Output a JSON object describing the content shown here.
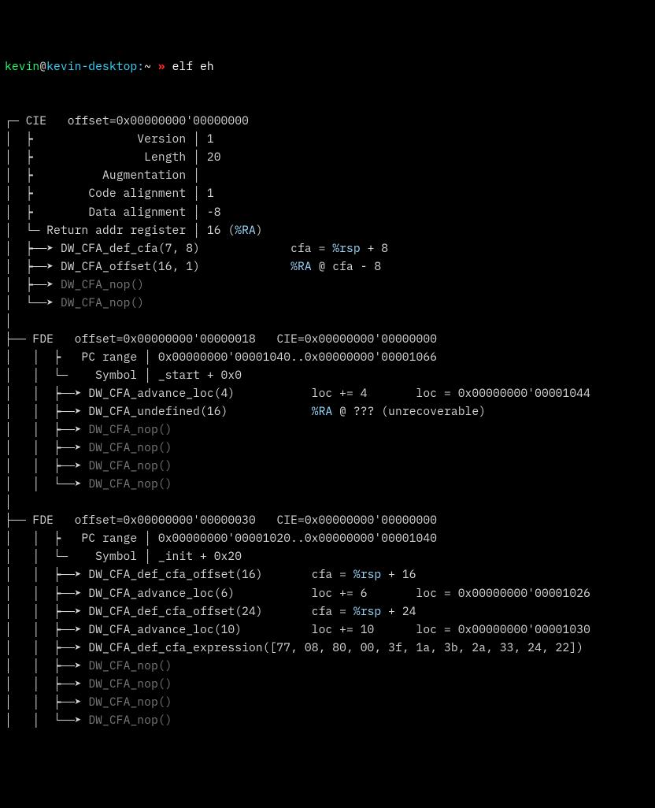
{
  "prompt": {
    "user": "kevin",
    "host": "kevin-desktop",
    "colon": ":",
    "path": "~",
    "arrows": "»",
    "cmd": "elf eh"
  },
  "t": {
    "blank": "",
    "cie_hdr_pre": "┌─ CIE   offset=0x00000000'00000000",
    "cie_version": "│  ┝               Version │ 1",
    "cie_length": "│  ┝                Length │ 20",
    "cie_aug": "│  ┝          Augmentation │",
    "cie_code_align": "│  ┝        Code alignment │ 1",
    "cie_data_align": "│  ┝        Data alignment │ -8",
    "cie_ret_left": "│  └─ Return addr register │ 16 (",
    "cie_ret_reg": "%RA",
    "cie_ret_right": ")",
    "cie_op1_l": "│  ┝──➤ DW_CFA_def_cfa(7, 8)             cfa = ",
    "cie_op1_reg": "%rsp",
    "cie_op1_r": " + 8",
    "cie_op2_l": "│  ┝──➤ DW_CFA_offset(16, 1)             ",
    "cie_op2_reg": "%RA",
    "cie_op2_r": " @ cfa - 8",
    "cie_nop1": "│  ┝──➤ ",
    "cie_nop1t": "DW_CFA_nop()",
    "cie_nop2": "│  └──➤ ",
    "cie_nop2t": "DW_CFA_nop()",
    "bar": "│",
    "fde1_hdr": "├── FDE   offset=0x00000000'00000018   CIE=0x00000000'00000000",
    "fde1_pc": "│   │  ┝   PC range │ 0x00000000'00001040..0x00000000'00001066",
    "fde1_sym": "│   │  └─    Symbol │ _start + 0x0",
    "fde1_op1": "│   │  ┝──➤ DW_CFA_advance_loc(4)           loc += 4       loc = 0x00000000'00001044",
    "fde1_op2_l": "│   │  ┝──➤ DW_CFA_undefined(16)            ",
    "fde1_op2_reg": "%RA",
    "fde1_op2_r": " @ ??? (unrecoverable)",
    "fde1_nop_p": "│   │  ┝──➤ ",
    "fde1_nop_t": "DW_CFA_nop()",
    "fde1_nop_pl": "│   │  └──➤ ",
    "fde2_hdr": "├── FDE   offset=0x00000000'00000030   CIE=0x00000000'00000000",
    "fde2_pc": "│   │  ┝   PC range │ 0x00000000'00001020..0x00000000'00001040",
    "fde2_sym": "│   │  └─    Symbol │ _init + 0x20",
    "fde2_op1_l": "│   │  ┝──➤ DW_CFA_def_cfa_offset(16)       cfa = ",
    "fde2_op1_reg": "%rsp",
    "fde2_op1_r": " + 16",
    "fde2_op2": "│   │  ┝──➤ DW_CFA_advance_loc(6)           loc += 6       loc = 0x00000000'00001026",
    "fde2_op3_l": "│   │  ┝──➤ DW_CFA_def_cfa_offset(24)       cfa = ",
    "fde2_op3_reg": "%rsp",
    "fde2_op3_r": " + 24",
    "fde2_op4": "│   │  ┝──➤ DW_CFA_advance_loc(10)          loc += 10      loc = 0x00000000'00001030",
    "fde2_op5": "│   │  ┝──➤ DW_CFA_def_cfa_expression([77, 08, 80, 00, 3f, 1a, 3b, 2a, 33, 24, 22])",
    "fde2_nop_p": "│   │  ┝──➤ ",
    "fde2_nop_t": "DW_CFA_nop()",
    "fde2_nop_pl": "│   │  └──➤ "
  }
}
